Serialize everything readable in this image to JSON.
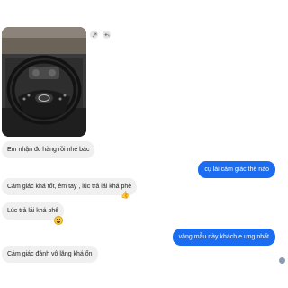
{
  "messages": [
    {
      "from": "them",
      "kind": "image",
      "alt": "car-steering-wheel-photo"
    },
    {
      "from": "them",
      "kind": "text",
      "text": "Em nhận đc hàng rồi nhé bác"
    },
    {
      "from": "me",
      "kind": "text",
      "text": "cụ lái cảm giác thế nào"
    },
    {
      "from": "them",
      "kind": "text",
      "text": "Cảm giác khá tốt, êm tay , lúc trả lái khá phê"
    },
    {
      "from": "them",
      "kind": "text",
      "text": "Lúc trả lái khá phê"
    },
    {
      "from": "me",
      "kind": "text",
      "text": "vâng mẫu này khách e ưng nhất"
    },
    {
      "from": "them",
      "kind": "text",
      "text": "Cảm giác đánh vô lăng khá ổn"
    }
  ],
  "colors": {
    "outgoing": "#1a6cf0",
    "incoming": "#f0f0f0",
    "background": "#ffffff"
  },
  "icons": {
    "image_actions": [
      "share-icon",
      "reply-icon"
    ],
    "reactions": [
      "thumbs-up-icon",
      "laughing-emoji-icon"
    ]
  }
}
